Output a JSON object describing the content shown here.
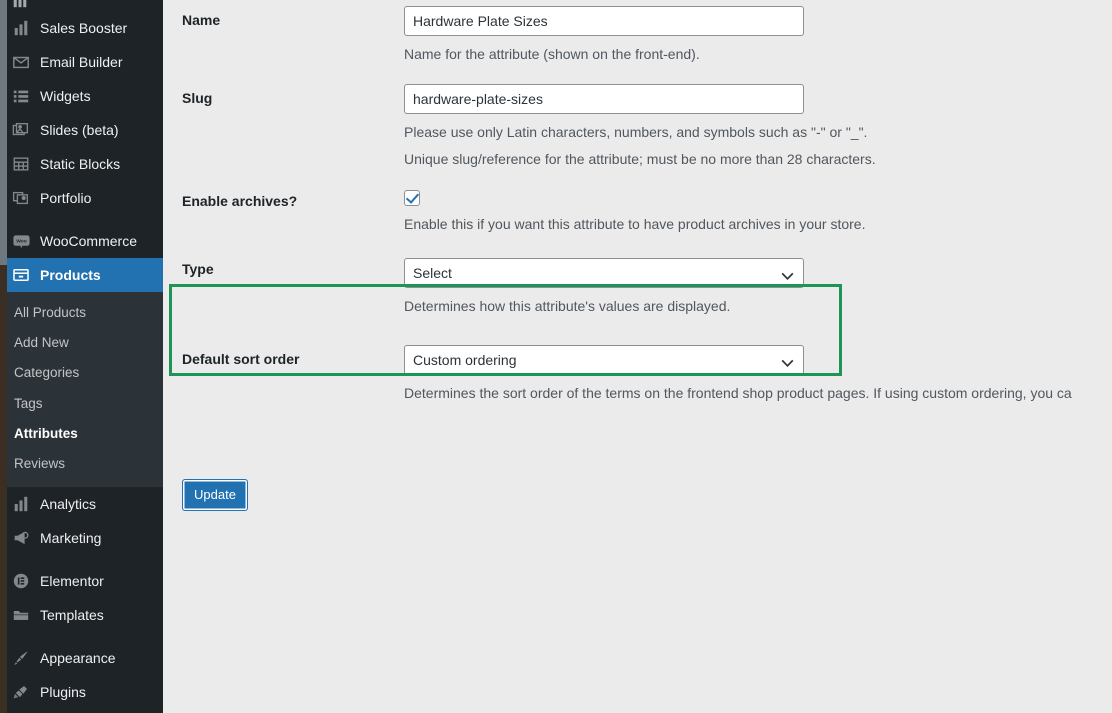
{
  "sidebar": {
    "items": [
      {
        "label": "Sales Booster",
        "icon": "bar-chart-icon",
        "name": "sales-booster"
      },
      {
        "label": "Email Builder",
        "icon": "envelope-icon",
        "name": "email-builder"
      },
      {
        "label": "Widgets",
        "icon": "widgets-icon",
        "name": "widgets"
      },
      {
        "label": "Slides (beta)",
        "icon": "images-icon",
        "name": "slides-beta"
      },
      {
        "label": "Static Blocks",
        "icon": "table-icon",
        "name": "static-blocks"
      },
      {
        "label": "Portfolio",
        "icon": "portfolio-icon",
        "name": "portfolio"
      },
      {
        "label": "WooCommerce",
        "icon": "woocommerce-icon",
        "name": "woocommerce"
      },
      {
        "label": "Products",
        "icon": "products-icon",
        "name": "products"
      },
      {
        "label": "Analytics",
        "icon": "bar-chart-icon",
        "name": "analytics"
      },
      {
        "label": "Marketing",
        "icon": "megaphone-icon",
        "name": "marketing"
      },
      {
        "label": "Elementor",
        "icon": "elementor-icon",
        "name": "elementor"
      },
      {
        "label": "Templates",
        "icon": "folder-icon",
        "name": "templates"
      },
      {
        "label": "Appearance",
        "icon": "paintbrush-icon",
        "name": "appearance"
      },
      {
        "label": "Plugins",
        "icon": "plug-icon",
        "name": "plugins"
      }
    ],
    "current_item": "Products",
    "submenu": [
      {
        "label": "All Products",
        "active": false
      },
      {
        "label": "Add New",
        "active": false
      },
      {
        "label": "Categories",
        "active": false
      },
      {
        "label": "Tags",
        "active": false
      },
      {
        "label": "Attributes",
        "active": true
      },
      {
        "label": "Reviews",
        "active": false
      }
    ]
  },
  "form": {
    "name": {
      "label": "Name",
      "value": "Hardware Plate Sizes",
      "description": "Name for the attribute (shown on the front-end)."
    },
    "slug": {
      "label": "Slug",
      "value": "hardware-plate-sizes",
      "description_1": "Please use only Latin characters, numbers, and symbols such as \"-\" or \"_\".",
      "description_2": "Unique slug/reference for the attribute; must be no more than 28 characters."
    },
    "enable_archives": {
      "label": "Enable archives?",
      "checked": true,
      "description": "Enable this if you want this attribute to have product archives in your store."
    },
    "type": {
      "label": "Type",
      "value": "Select",
      "description": "Determines how this attribute's values are displayed."
    },
    "sort_order": {
      "label": "Default sort order",
      "value": "Custom ordering",
      "description": "Determines the sort order of the terms on the frontend shop product pages. If using custom ordering, you ca"
    },
    "submit_label": "Update"
  },
  "colors": {
    "highlight": "#1e9457",
    "accent": "#2271b1",
    "sidebar_bg": "#1d2327",
    "submenu_bg": "#2c3338"
  }
}
